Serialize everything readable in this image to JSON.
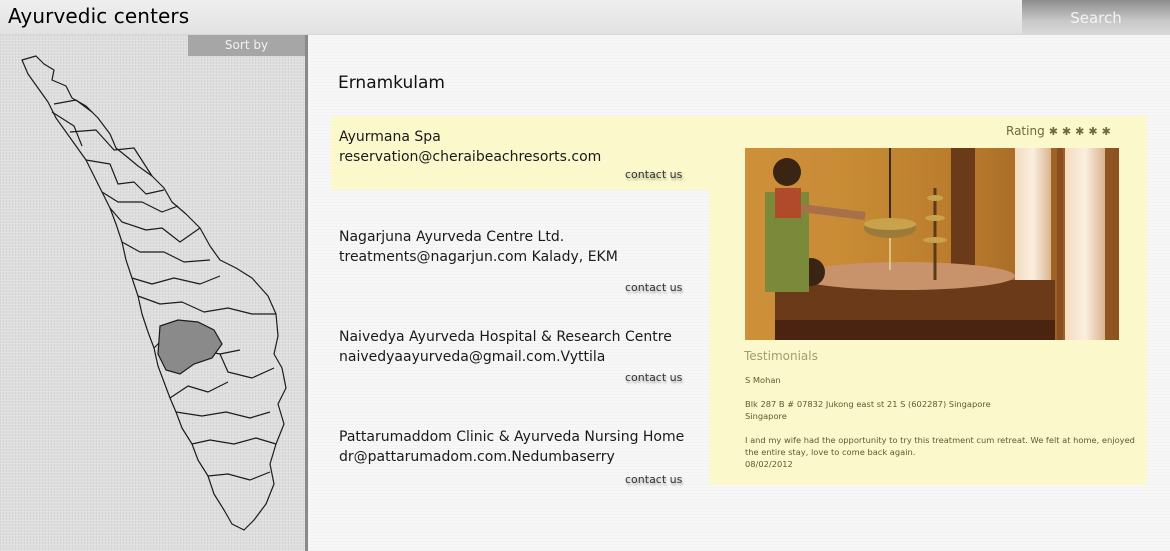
{
  "header": {
    "title": "Ayurvedic centers",
    "search_label": "Search"
  },
  "sidebar": {
    "sort_label": "Sort by",
    "map_highlighted_district": "Ernamkulam"
  },
  "main": {
    "district": "Ernamkulam",
    "contact_label": "contact us",
    "centers": [
      {
        "name": "Ayurmana Spa",
        "email": "reservation@cheraibeachresorts.com",
        "selected": true
      },
      {
        "name": "Nagarjuna Ayurveda Centre Ltd.",
        "email": "treatments@nagarjun.com  Kalady, EKM",
        "selected": false
      },
      {
        "name": "Naivedya Ayurveda Hospital & Research Centre",
        "email": "naivedyaayurveda@gmail.com.Vyttila",
        "selected": false
      },
      {
        "name": "Pattarumaddom Clinic & Ayurveda Nursing Home",
        "email": "dr@pattarumadom.com.Nedumbaserry",
        "selected": false
      }
    ]
  },
  "detail": {
    "rating_label": "Rating",
    "rating_stars": "✱✱✱✱✱",
    "rating_value": 5,
    "testimonials_heading": "Testimonials",
    "testimonial": {
      "name": "S Mohan",
      "address_line1": "Blk 287 B # 07832 Jukong east st 21 S (602287) Singapore",
      "address_line2": "Singapore",
      "text": "I and my wife had the opportunity to try this treatment cum retreat. We felt at home, enjoyed the entire stay, love to come back again.",
      "date": "08/02/2012"
    }
  },
  "colors": {
    "selected_bg": "#fbf9cc",
    "accent_text": "#a29e6e",
    "highlight_district": "#8a8a8a"
  }
}
